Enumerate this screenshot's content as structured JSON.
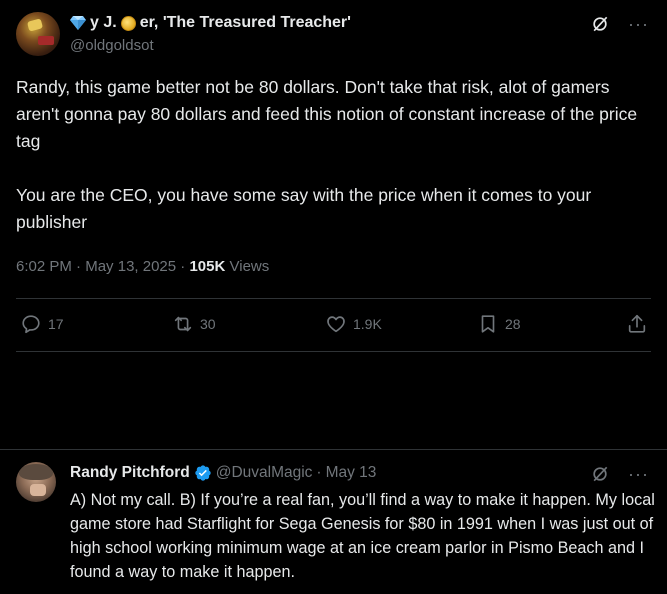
{
  "tweet": {
    "display_name": "y J.  er, 'The Treasured Treacher'",
    "name_prefix": "y J.",
    "name_suffix": "er, 'The Treasured Treacher'",
    "handle": "@oldgoldsot",
    "text": "Randy, this game better not be 80 dollars. Don't take that risk, alot of gamers aren't gonna pay 80 dollars and feed this notion of constant increase of the price tag\n\nYou are the CEO, you have some say with the price when it comes to your publisher",
    "time": "6:02 PM",
    "date": "May 13, 2025",
    "views_count": "105K",
    "views_label": "Views",
    "separator": "·"
  },
  "actions": {
    "replies": "17",
    "reposts": "30",
    "likes": "1.9K",
    "bookmarks": "28"
  },
  "reply": {
    "name": "Randy Pitchford",
    "handle": "@DuvalMagic",
    "dot": "·",
    "date": "May 13",
    "text": "A) Not my call. B) If you’re a real fan, you’ll find a way to make it happen. My local game store had Starflight for Sega Genesis for $80 in 1991 when I was just out of high school working minimum wage at an ice cream parlor in Pismo Beach and I found a way to make it happen."
  },
  "colors": {
    "background": "#000000",
    "text_primary": "#e7e9ea",
    "text_secondary": "#71767b",
    "divider": "#2f3336",
    "verified_blue": "#1d9bf0"
  },
  "icons": [
    "gem-icon",
    "coin-icon",
    "grok-icon",
    "more-icon",
    "reply-icon",
    "repost-icon",
    "like-icon",
    "bookmark-icon",
    "share-icon",
    "verified-badge-icon"
  ]
}
